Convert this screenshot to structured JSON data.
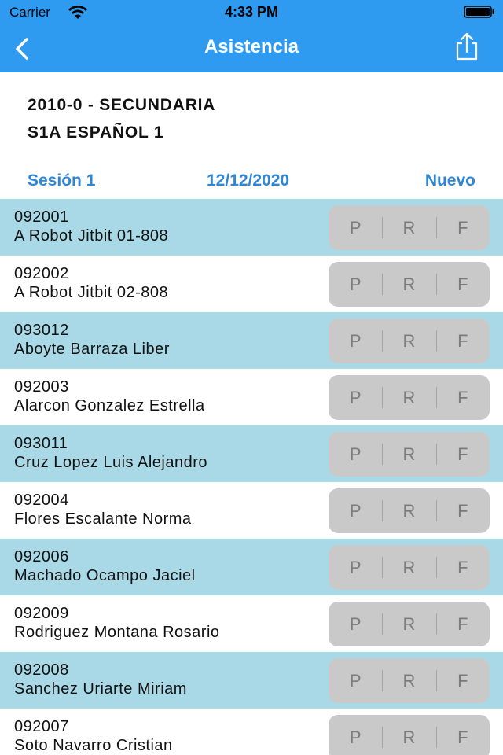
{
  "status_bar": {
    "carrier": "Carrier",
    "time": "4:33 PM"
  },
  "nav": {
    "title": "Asistencia"
  },
  "header": {
    "line1": "2010-0 - SECUNDARIA",
    "line2": "S1A  ESPAÑOL 1"
  },
  "session": {
    "label": "Sesión 1",
    "date": "12/12/2020",
    "new_label": "Nuevo"
  },
  "attendance_options": [
    "P",
    "R",
    "F"
  ],
  "students": [
    {
      "code": "092001",
      "name": "A Robot Jitbit 01-808"
    },
    {
      "code": "092002",
      "name": "A Robot Jitbit 02-808"
    },
    {
      "code": "093012",
      "name": "Aboyte Barraza Liber"
    },
    {
      "code": "092003",
      "name": "Alarcon Gonzalez Estrella"
    },
    {
      "code": "093011",
      "name": "Cruz Lopez Luis Alejandro"
    },
    {
      "code": "092004",
      "name": "Flores Escalante Norma"
    },
    {
      "code": "092006",
      "name": "Machado Ocampo Jaciel"
    },
    {
      "code": "092009",
      "name": "Rodriguez Montana Rosario"
    },
    {
      "code": "092008",
      "name": "Sanchez Uriarte Miriam"
    },
    {
      "code": "092007",
      "name": "Soto Navarro Cristian"
    }
  ],
  "colors": {
    "nav_bar": "#2f9bf0",
    "accent": "#2f86d6",
    "row_alt": "#a9d8e6",
    "segment_bg": "#c9c9c9"
  }
}
